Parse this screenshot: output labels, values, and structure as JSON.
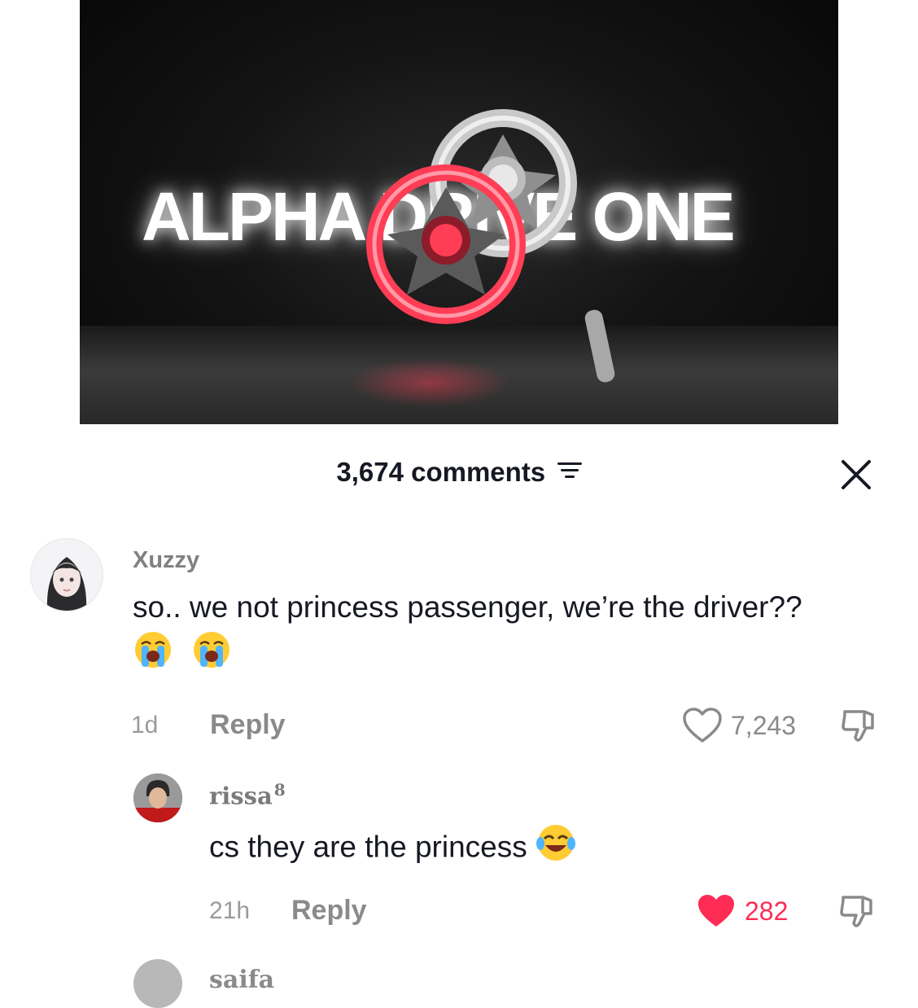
{
  "video": {
    "title_text": "ALPHA DRIVE ONE"
  },
  "comments_panel": {
    "count_label": "3,674 comments",
    "icons": {
      "filter": "filter-lines-icon",
      "close": "close-x-icon"
    }
  },
  "comments": [
    {
      "username": "Xuzzy",
      "text": "so.. we not princess passenger, we’re the driver??",
      "emojis": [
        "loudly-crying-face",
        "loudly-crying-face"
      ],
      "time": "1d",
      "reply_label": "Reply",
      "likes": "7,243",
      "liked": false
    }
  ],
  "replies": [
    {
      "username": "rissa",
      "badge": "8",
      "text": "cs they are the princess",
      "emojis": [
        "face-with-tears-of-joy"
      ],
      "time": "21h",
      "reply_label": "Reply",
      "likes": "282",
      "liked": true
    }
  ],
  "next_comment": {
    "username_partial": "saifa"
  },
  "colors": {
    "liked": "#fe2c55",
    "muted": "#8a8a8a",
    "text": "#161823"
  }
}
